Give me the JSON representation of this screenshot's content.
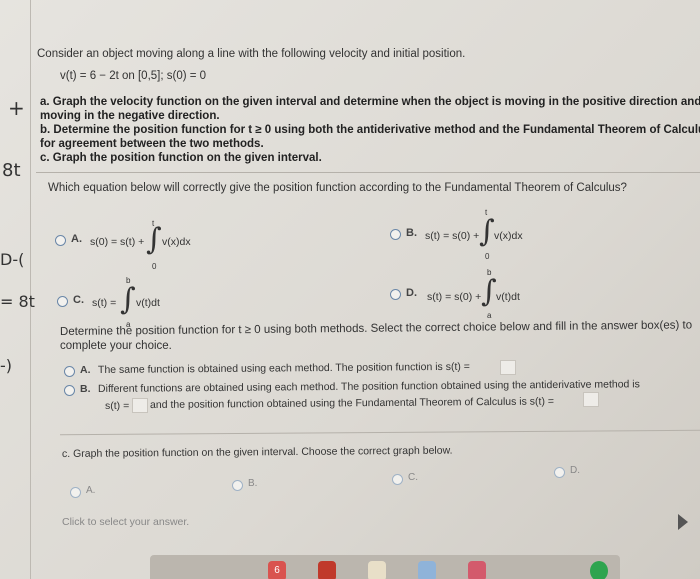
{
  "problem": {
    "intro": "Consider an object moving along a line with the following velocity and initial position.",
    "given": "v(t) = 6 − 2t on [0,5]; s(0) = 0",
    "part_a": "a. Graph the velocity function on the given interval and determine when the object is moving in the positive direction and when it",
    "part_a_cont": "moving in the negative direction.",
    "part_b": "b. Determine the position function for t ≥ 0 using both the antiderivative method and the Fundamental Theorem of Calculus. Che",
    "part_b_cont": "for agreement between the two methods.",
    "part_c": "c. Graph the position function on the given interval."
  },
  "question1": {
    "prompt": "Which equation below will correctly give the position function according to the Fundamental Theorem of Calculus?",
    "options": [
      {
        "letter": "A.",
        "lhs": "s(0) = s(t) +",
        "integrand": "v(x)dx",
        "upper": "t",
        "lower": "0"
      },
      {
        "letter": "B.",
        "lhs": "s(t) = s(0) +",
        "integrand": "v(x)dx",
        "upper": "t",
        "lower": "0"
      },
      {
        "letter": "C.",
        "lhs": "s(t) =",
        "integrand": "v(t)dt",
        "upper": "b",
        "lower": "a"
      },
      {
        "letter": "D.",
        "lhs": "s(t) = s(0) +",
        "integrand": "v(t)dt",
        "upper": "b",
        "lower": "a"
      }
    ]
  },
  "question2": {
    "prompt": "Determine the position function for t ≥ 0 using both methods. Select the correct choice below and fill in the answer box(es) to",
    "prompt_cont": "complete your choice.",
    "optA_letter": "A.",
    "optA": "The same function is obtained using each method. The position function is s(t) =",
    "optB_letter": "B.",
    "optB_line1": "Different functions are obtained using each method. The position function obtained using the antiderivative method is",
    "optB_line2a": "s(t) =",
    "optB_line2b": "and the position function obtained using the Fundamental Theorem of Calculus is s(t) ="
  },
  "question3": {
    "prompt": "c. Graph the position function on the given interval. Choose the correct graph below.",
    "options": [
      "A.",
      "B.",
      "C.",
      "D."
    ]
  },
  "footer": {
    "hint": "Click to select your answer."
  },
  "margin_notes": {
    "plus": "+",
    "st1": "8t",
    "dash": "D-(",
    "st2": "= 8t",
    "paren": "-)"
  },
  "dock": {
    "badge": "6"
  }
}
